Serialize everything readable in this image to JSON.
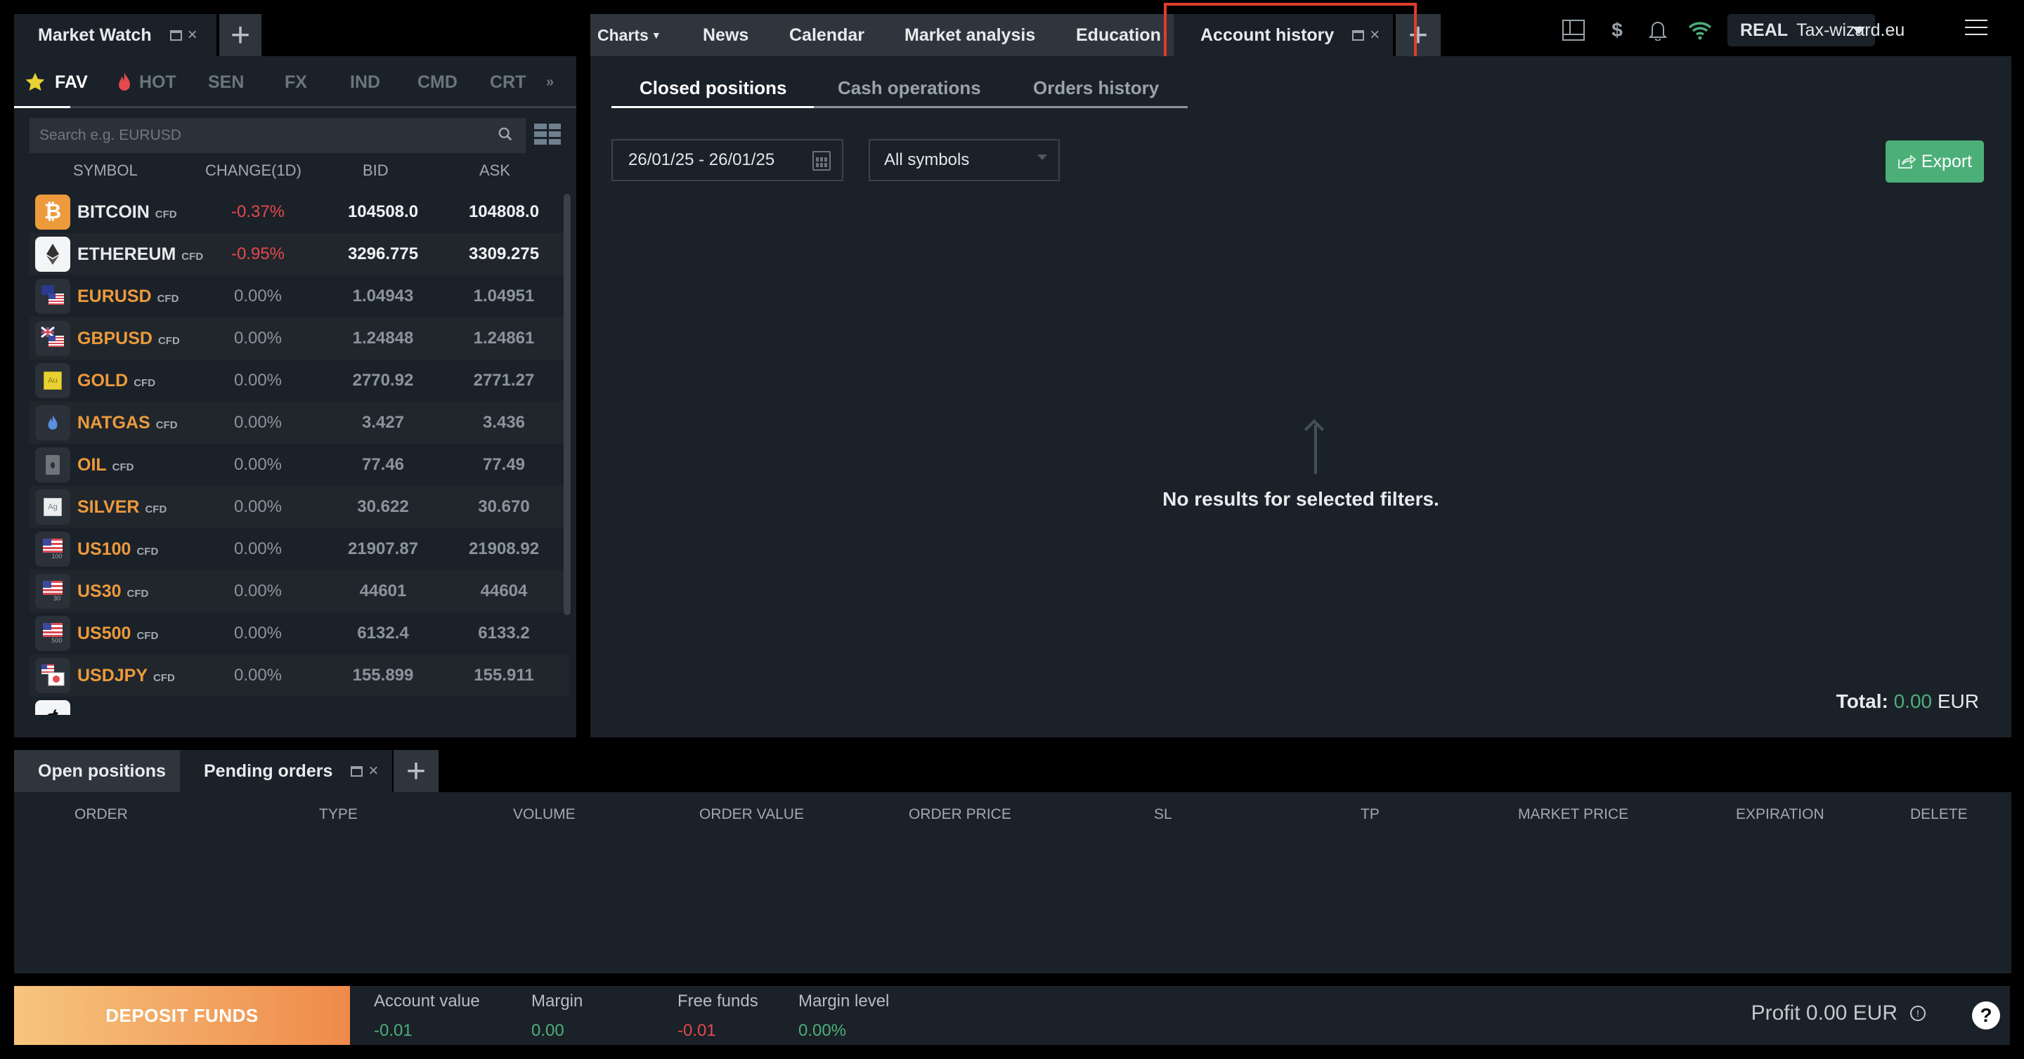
{
  "market_watch": {
    "tab_title": "Market Watch",
    "categories": [
      {
        "label": "FAV",
        "icon": "star-icon",
        "active": true
      },
      {
        "label": "HOT",
        "icon": "fire-icon",
        "active": false
      },
      {
        "label": "SEN",
        "active": false
      },
      {
        "label": "FX",
        "active": false
      },
      {
        "label": "IND",
        "active": false
      },
      {
        "label": "CMD",
        "active": false
      },
      {
        "label": "CRT",
        "active": false
      }
    ],
    "more_icon": "double-chevron-right-icon",
    "search_placeholder": "Search e.g. EURUSD",
    "columns": [
      "SYMBOL",
      "CHANGE(1D)",
      "BID",
      "ASK"
    ],
    "rows": [
      {
        "symbol": "BITCOIN",
        "type": "CFD",
        "change": "-0.37%",
        "bid": "104508.0",
        "ask": "104808.0",
        "icon": "bitcoin-icon"
      },
      {
        "symbol": "ETHEREUM",
        "type": "CFD",
        "change": "-0.95%",
        "bid": "3296.775",
        "ask": "3309.275",
        "icon": "ethereum-icon"
      },
      {
        "symbol": "EURUSD",
        "type": "CFD",
        "change": "0.00%",
        "bid": "1.04943",
        "ask": "1.04951",
        "icon": "eu-us-flag-icon"
      },
      {
        "symbol": "GBPUSD",
        "type": "CFD",
        "change": "0.00%",
        "bid": "1.24848",
        "ask": "1.24861",
        "icon": "uk-us-flag-icon"
      },
      {
        "symbol": "GOLD",
        "type": "CFD",
        "change": "0.00%",
        "bid": "2770.92",
        "ask": "2771.27",
        "icon": "gold-icon"
      },
      {
        "symbol": "NATGAS",
        "type": "CFD",
        "change": "0.00%",
        "bid": "3.427",
        "ask": "3.436",
        "icon": "gas-flame-icon"
      },
      {
        "symbol": "OIL",
        "type": "CFD",
        "change": "0.00%",
        "bid": "77.46",
        "ask": "77.49",
        "icon": "oil-barrel-icon"
      },
      {
        "symbol": "SILVER",
        "type": "CFD",
        "change": "0.00%",
        "bid": "30.622",
        "ask": "30.670",
        "icon": "silver-icon"
      },
      {
        "symbol": "US100",
        "type": "CFD",
        "change": "0.00%",
        "bid": "21907.87",
        "ask": "21908.92",
        "icon": "us-index-flag-icon",
        "badge": "100"
      },
      {
        "symbol": "US30",
        "type": "CFD",
        "change": "0.00%",
        "bid": "44601",
        "ask": "44604",
        "icon": "us-index-flag-icon",
        "badge": "30"
      },
      {
        "symbol": "US500",
        "type": "CFD",
        "change": "0.00%",
        "bid": "6132.4",
        "ask": "6133.2",
        "icon": "us-index-flag-icon",
        "badge": "500"
      },
      {
        "symbol": "USDJPY",
        "type": "CFD",
        "change": "0.00%",
        "bid": "155.899",
        "ask": "155.911",
        "icon": "us-jp-flag-icon"
      }
    ],
    "partial_row_icon": "apple-icon"
  },
  "center_tabs": [
    {
      "label": "Charts",
      "dropdown": true
    },
    {
      "label": "News"
    },
    {
      "label": "Calendar"
    },
    {
      "label": "Market analysis"
    },
    {
      "label": "Education"
    },
    {
      "label": "Account history",
      "active": true
    }
  ],
  "account_history": {
    "sub_tabs": [
      "Closed positions",
      "Cash operations",
      "Orders history"
    ],
    "active_sub_tab": "Closed positions",
    "date_range": "26/01/25 - 26/01/25",
    "symbol_filter": "All symbols",
    "export_label": "Export",
    "empty_message": "No results for selected filters.",
    "total_label": "Total:",
    "total_value": "0.00",
    "total_currency": "EUR"
  },
  "toolbar": {
    "icons": [
      "layout-icon",
      "dollar-signal-icon",
      "bell-icon",
      "wifi-icon"
    ],
    "account_type": "REAL",
    "account_name": "Tax-wizard.eu",
    "menu_icon": "hamburger-menu-icon"
  },
  "bottom_tabs": [
    {
      "label": "Open positions",
      "active": false
    },
    {
      "label": "Pending orders",
      "active": true
    }
  ],
  "orders_table": {
    "columns": [
      "ORDER",
      "TYPE",
      "VOLUME",
      "ORDER VALUE",
      "ORDER PRICE",
      "SL",
      "TP",
      "MARKET PRICE",
      "EXPIRATION",
      "DELETE"
    ]
  },
  "footer": {
    "deposit_label": "DEPOSIT FUNDS",
    "stats": [
      {
        "label": "Account value",
        "value": "-0.01",
        "color": "green"
      },
      {
        "label": "Margin",
        "value": "0.00",
        "color": "green"
      },
      {
        "label": "Free funds",
        "value": "-0.01",
        "color": "red"
      },
      {
        "label": "Margin level",
        "value": "0.00%",
        "color": "green"
      }
    ],
    "profit_label": "Profit 0.00 EUR",
    "help_label": "?"
  },
  "colors": {
    "accent_green": "#4caf78",
    "negative_red": "#e5484d",
    "symbol_orange": "#ec9a3c",
    "highlight_red": "#e03c2c"
  }
}
